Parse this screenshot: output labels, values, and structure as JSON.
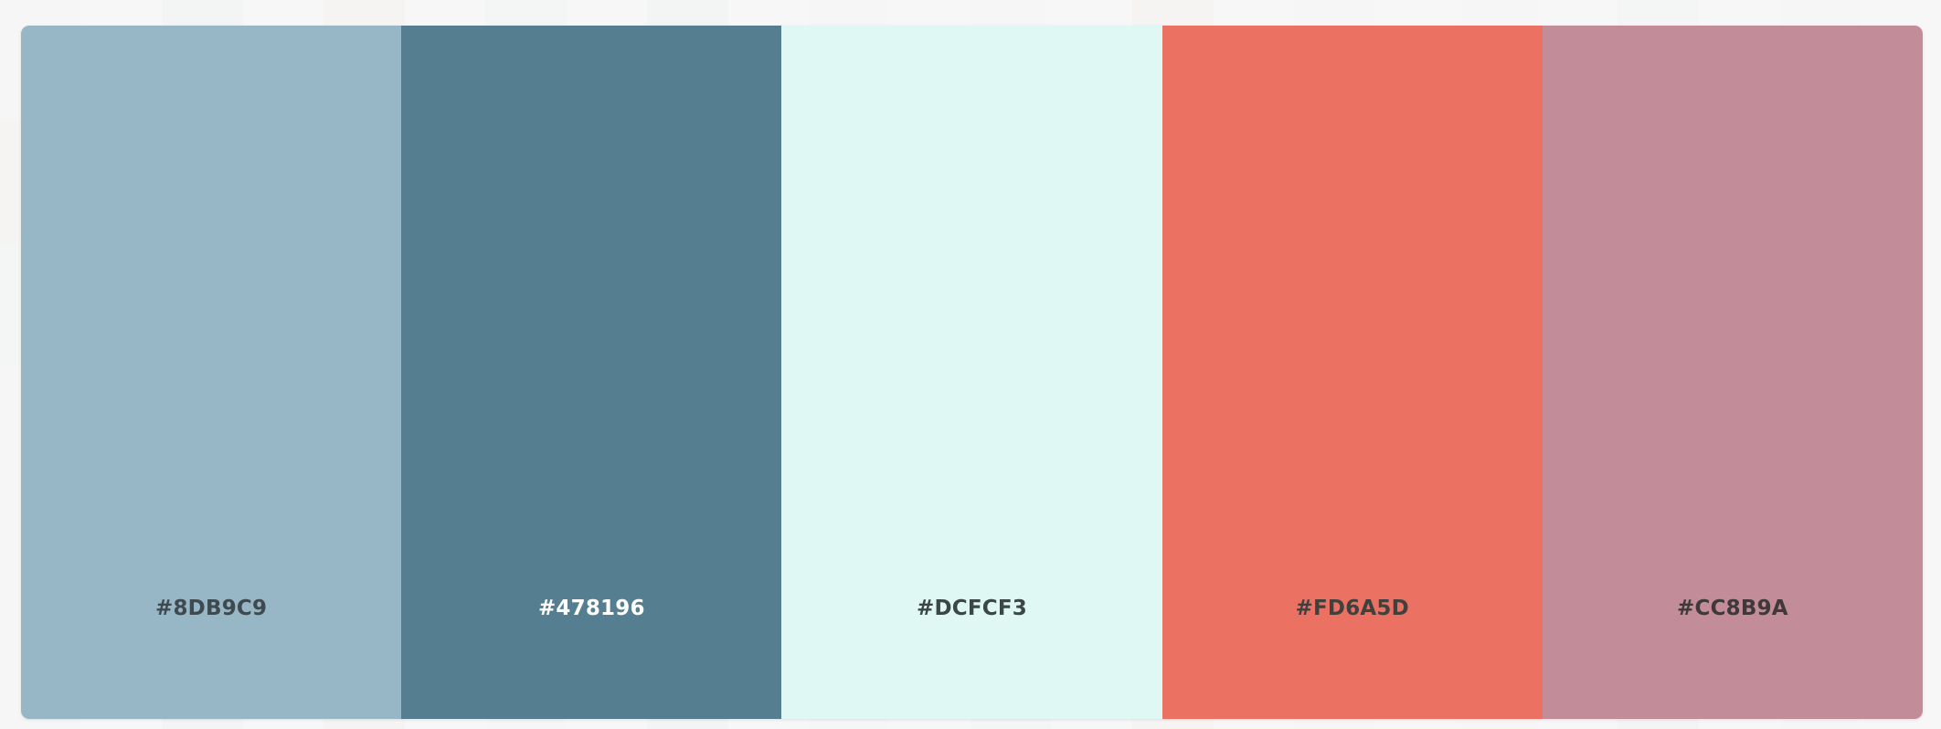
{
  "palette": {
    "swatches": [
      {
        "label": "#8DB9C9",
        "color": "#97b7c6",
        "text_color": "#3f4a50"
      },
      {
        "label": "#478196",
        "color": "#557e91",
        "text_color": "#ffffff"
      },
      {
        "label": "#DCFCF3",
        "color": "#e0f8f3",
        "text_color": "#3b4646"
      },
      {
        "label": "#FD6A5D",
        "color": "#eb7262",
        "text_color": "#40403f"
      },
      {
        "label": "#CC8B9A",
        "color": "#c28c98",
        "text_color": "#40393c"
      }
    ]
  }
}
